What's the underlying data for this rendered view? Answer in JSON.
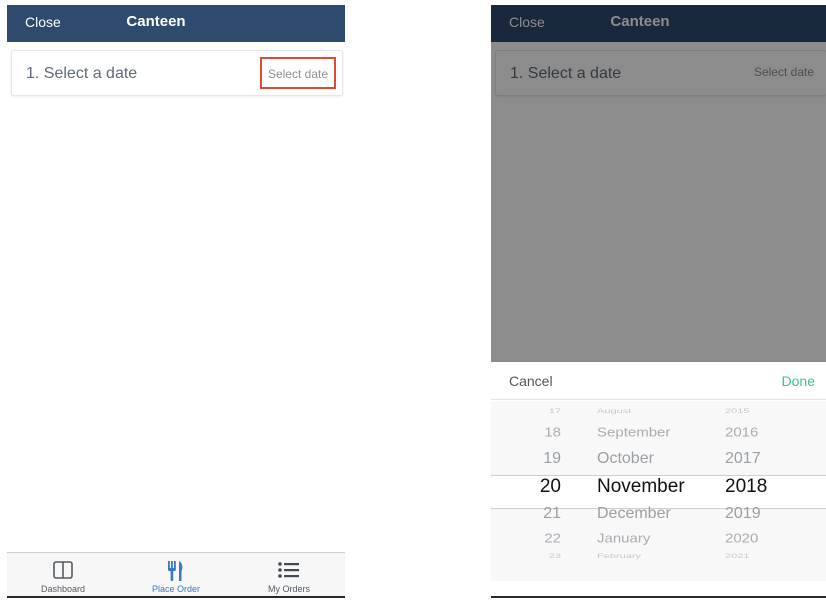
{
  "left_screen": {
    "navbar": {
      "close_label": "Close",
      "title": "Canteen"
    },
    "card": {
      "step_label": "1. Select a date",
      "action_label": "Select date"
    },
    "tabs": [
      {
        "label": "Dashboard",
        "icon": "dashboard-icon"
      },
      {
        "label": "Place Order",
        "icon": "cutlery-icon",
        "active": true
      },
      {
        "label": "My Orders",
        "icon": "list-icon"
      }
    ]
  },
  "right_screen": {
    "navbar": {
      "close_label": "Close",
      "title": "Canteen"
    },
    "card": {
      "step_label": "1. Select a date",
      "action_label": "Select date"
    },
    "picker_toolbar": {
      "cancel_label": "Cancel",
      "done_label": "Done"
    },
    "date_picker": {
      "days": [
        "17",
        "18",
        "19",
        "20",
        "21",
        "22",
        "23"
      ],
      "months": [
        "August",
        "September",
        "October",
        "November",
        "December",
        "January",
        "February"
      ],
      "years": [
        "2015",
        "2016",
        "2017",
        "2018",
        "2019",
        "2020",
        "2021"
      ],
      "selected": {
        "day": "20",
        "month": "November",
        "year": "2018"
      }
    }
  },
  "colors": {
    "navbar": "#2e4a6f",
    "highlight_box": "#e04a34",
    "active_tab": "#3b78c3",
    "done": "#3fc38b"
  }
}
